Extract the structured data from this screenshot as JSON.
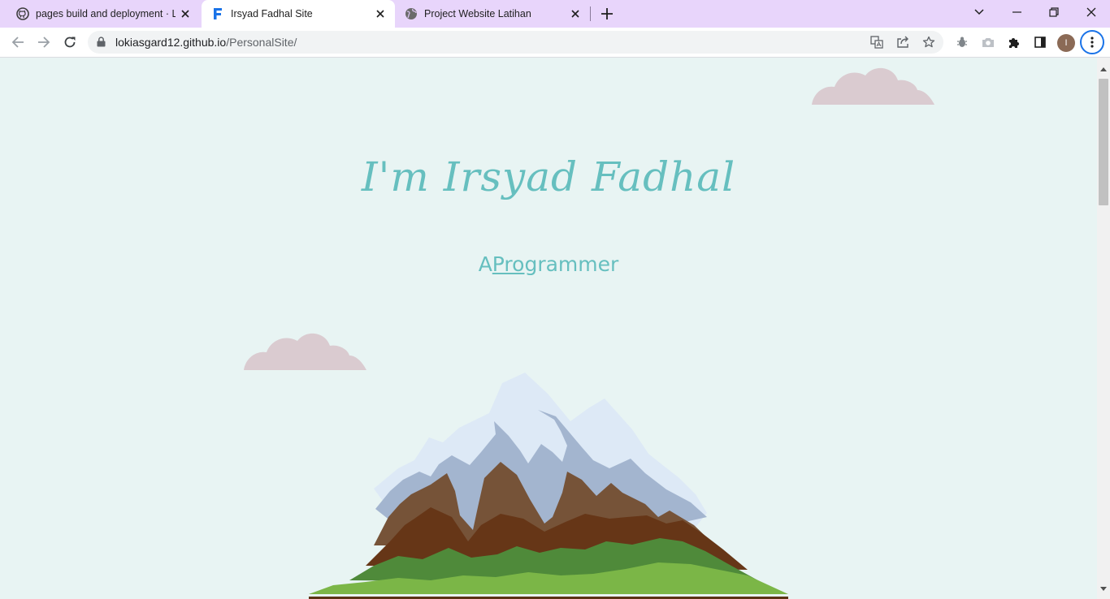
{
  "browser": {
    "tabs": [
      {
        "title": "pages build and deployment · Lo",
        "icon": "github-icon"
      },
      {
        "title": "Irsyad Fadhal Site",
        "icon": "f-logo-icon",
        "active": true
      },
      {
        "title": "Project Website Latihan",
        "icon": "globe-icon"
      }
    ],
    "url_host": "lokiasgard12.github.io",
    "url_path": "/PersonalSite/",
    "avatar_letter": "I",
    "colors": {
      "tabstrip": "#e8d5fb",
      "accent": "#1a73e8"
    }
  },
  "page": {
    "title": "I'm Irsyad Fadhal",
    "subtitle_prefix": "A",
    "subtitle_underlined": "Pro",
    "subtitle_rest": "grammer",
    "colors": {
      "background": "#e8f4f3",
      "text": "#66bfbf",
      "cloud": "#dacbd0"
    }
  }
}
